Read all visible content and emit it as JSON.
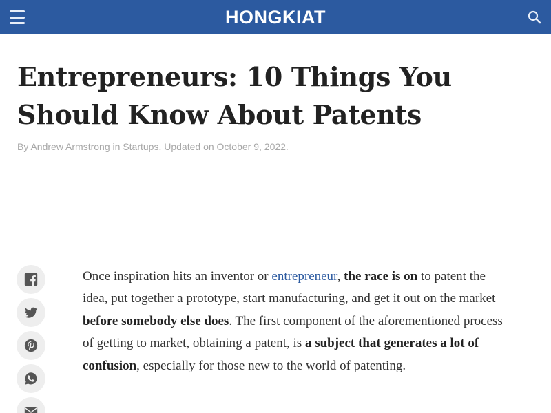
{
  "header": {
    "logo": "HONGKIAT",
    "colors": {
      "background": "#2c5aa0",
      "logo": "#ffffff"
    },
    "menu_icon": "hamburger-menu-icon",
    "search_icon": "search-icon"
  },
  "article": {
    "title_line1": "Entrepreneurs: 10 Things You",
    "title_line2": "Should Know About Patents",
    "byline": {
      "prefix": "By",
      "author": "Andrew Armstrong",
      "in": "in",
      "category": "Startups",
      "updated": ". Updated on October 9, 2022."
    },
    "body": {
      "s1": "Once inspiration hits an inventor or ",
      "link": "entrepreneur",
      "s2": ", ",
      "b1": "the race is on",
      "s3": " to patent the idea, put together a prototype, start manufacturing, and get it out on the market ",
      "b2": "before somebody else does",
      "s4": ". The first component of the aforementioned process of getting to market, obtaining a patent, is ",
      "b3": "a subject that generates a lot of confusion",
      "s5": ", especially for those new to the world of patenting."
    }
  },
  "share": {
    "icons": [
      "facebook-icon",
      "twitter-icon",
      "pinterest-icon",
      "whatsapp-icon",
      "email-icon"
    ]
  }
}
